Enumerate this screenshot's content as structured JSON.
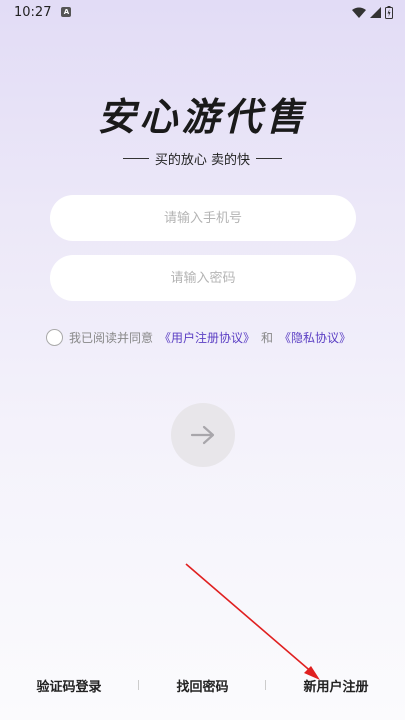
{
  "status_bar": {
    "time": "10:27",
    "notification_icon": "A",
    "icons": [
      "wifi-icon",
      "signal-icon",
      "battery-icon"
    ]
  },
  "brand": {
    "title": "安心游代售",
    "slogan": "买的放心 卖的快"
  },
  "form": {
    "phone_placeholder": "请输入手机号",
    "password_placeholder": "请输入密码",
    "agreement_prefix": "我已阅读并同意",
    "user_agreement_link": "《用户注册协议》",
    "agreement_and": "和",
    "privacy_link": "《隐私协议》"
  },
  "submit_icon": "arrow-right-icon",
  "bottom_nav": {
    "sms_login": "验证码登录",
    "find_password": "找回密码",
    "register": "新用户注册"
  },
  "colors": {
    "link": "#5b3fc4",
    "annotation_arrow": "#e02020"
  }
}
